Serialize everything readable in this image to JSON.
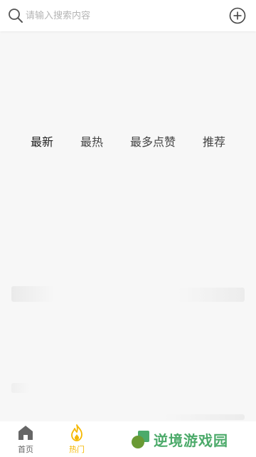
{
  "search": {
    "placeholder": "请输入搜索内容",
    "value": ""
  },
  "tabs": [
    {
      "label": "最新",
      "active": true
    },
    {
      "label": "最热",
      "active": false
    },
    {
      "label": "最多点赞",
      "active": false
    },
    {
      "label": "推荐",
      "active": false
    }
  ],
  "bottom_nav": {
    "items": [
      {
        "label": "首页",
        "icon": "home-icon",
        "active": false,
        "color": "#666666"
      },
      {
        "label": "热门",
        "icon": "flame-icon",
        "active": true,
        "color": "#f5b800"
      }
    ]
  },
  "watermark": {
    "text": "逆境游戏园",
    "color": "#4caa6a"
  },
  "colors": {
    "background": "#f7f7f7",
    "accent": "#f5b800"
  }
}
